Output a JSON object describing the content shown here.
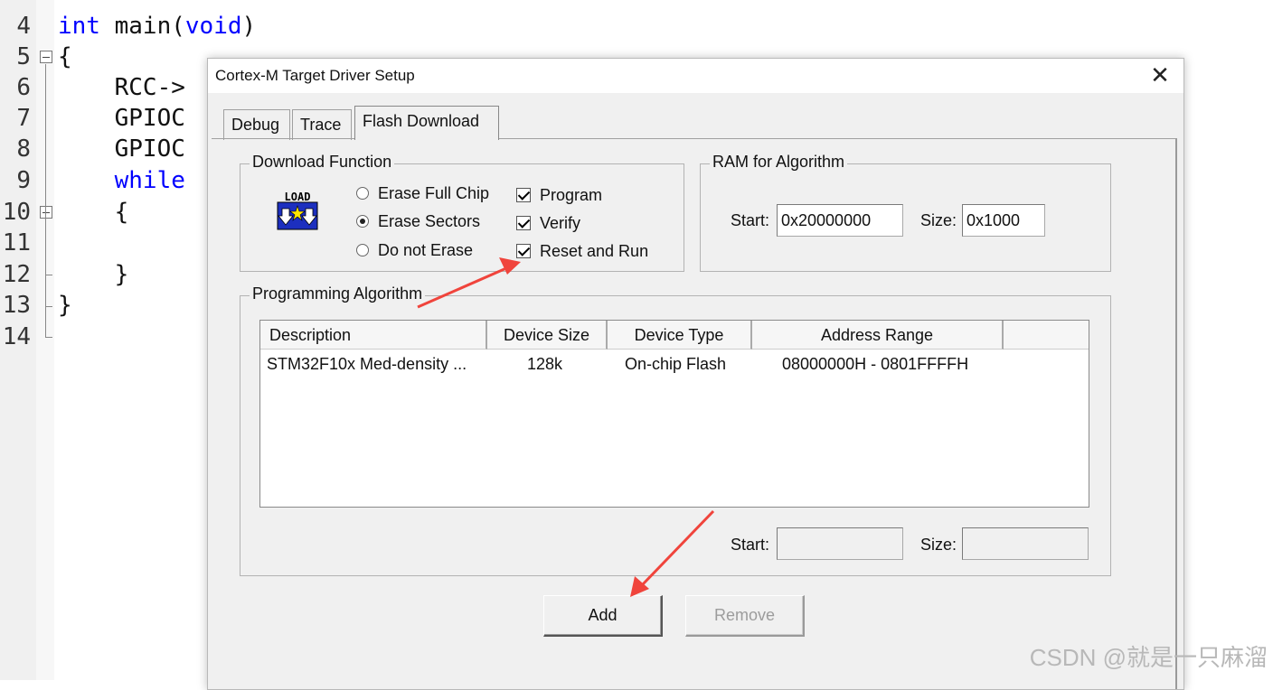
{
  "editor": {
    "lines": [
      {
        "num": "4",
        "code_kw": "int",
        "code_rest": " main(",
        "code_kw2": "void",
        "code_end": ")"
      },
      {
        "num": "5",
        "code": "{"
      },
      {
        "num": "6",
        "code": "    RCC->"
      },
      {
        "num": "7",
        "code": "    GPIOC"
      },
      {
        "num": "8",
        "code": "    GPIOC"
      },
      {
        "num": "9",
        "code_kw_only": "    while"
      },
      {
        "num": "10",
        "code": "    {"
      },
      {
        "num": "11",
        "code": ""
      },
      {
        "num": "12",
        "code": "    }"
      },
      {
        "num": "13",
        "code": "}"
      },
      {
        "num": "14",
        "code": ""
      }
    ],
    "keyword_color": "#0000ff"
  },
  "dialog": {
    "title": "Cortex-M Target Driver Setup",
    "close_glyph": "✕",
    "tabs": [
      {
        "label": "Debug"
      },
      {
        "label": "Trace"
      },
      {
        "label": "Flash Download",
        "active": true
      }
    ],
    "download_function": {
      "label": "Download Function",
      "icon": "load-icon",
      "icon_text": "LOAD",
      "radios": [
        {
          "label": "Erase Full Chip",
          "checked": false
        },
        {
          "label": "Erase Sectors",
          "checked": true
        },
        {
          "label": "Do not Erase",
          "checked": false
        }
      ],
      "checkboxes": [
        {
          "label": "Program",
          "checked": true
        },
        {
          "label": "Verify",
          "checked": true
        },
        {
          "label": "Reset and Run",
          "checked": true
        }
      ]
    },
    "ram": {
      "label": "RAM for Algorithm",
      "start_label": "Start:",
      "start_value": "0x20000000",
      "size_label": "Size:",
      "size_value": "0x1000"
    },
    "programming_algorithm": {
      "label": "Programming Algorithm",
      "columns": [
        "Description",
        "Device Size",
        "Device Type",
        "Address Range"
      ],
      "rows": [
        {
          "description": "STM32F10x Med-density ...",
          "size": "128k",
          "type": "On-chip Flash",
          "range": "08000000H - 0801FFFFH"
        }
      ],
      "start_label": "Start:",
      "start_value": "",
      "size_label": "Size:",
      "size_value": ""
    },
    "buttons": {
      "add": "Add",
      "remove": "Remove"
    }
  },
  "annotation_color": "#f0443c",
  "watermark": "CSDN @就是一只麻溜"
}
